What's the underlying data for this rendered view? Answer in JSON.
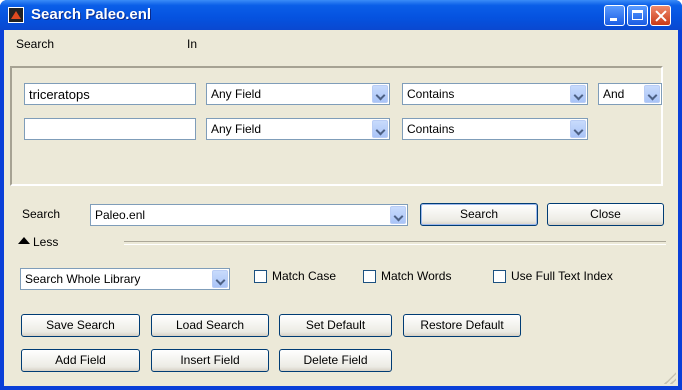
{
  "window": {
    "title": "Search Paleo.enl"
  },
  "criteria": {
    "search_header": "Search",
    "in_header": "In",
    "rows": [
      {
        "term": "triceratops",
        "field": "Any Field",
        "operator": "Contains",
        "bool": "And"
      },
      {
        "term": "",
        "field": "Any Field",
        "operator": "Contains"
      }
    ]
  },
  "search_row": {
    "label": "Search",
    "library": "Paleo.enl",
    "search_button": "Search",
    "close_button": "Close"
  },
  "less_label": "Less",
  "options": {
    "scope": "Search Whole Library",
    "match_case": {
      "label": "Match Case",
      "checked": false
    },
    "match_words": {
      "label": "Match Words",
      "checked": false
    },
    "full_text": {
      "label": "Use Full Text Index",
      "checked": false
    }
  },
  "buttons": {
    "save_search": "Save Search",
    "load_search": "Load Search",
    "set_default": "Set Default",
    "restore_default": "Restore Default",
    "add_field": "Add Field",
    "insert_field": "Insert Field",
    "delete_field": "Delete Field"
  }
}
